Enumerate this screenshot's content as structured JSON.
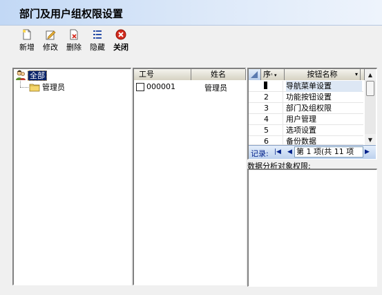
{
  "window": {
    "title": "部门及用户组权限设置"
  },
  "toolbar": {
    "buttons": [
      {
        "label": "新增",
        "icon": "new-file-icon"
      },
      {
        "label": "修改",
        "icon": "edit-icon"
      },
      {
        "label": "删除",
        "icon": "delete-file-icon"
      },
      {
        "label": "隐藏",
        "icon": "hide-list-icon"
      },
      {
        "label": "关闭",
        "icon": "close-circle-icon"
      }
    ]
  },
  "tree": {
    "root_label": "全部",
    "children": [
      "管理员"
    ]
  },
  "users": {
    "columns": [
      "工号",
      "姓名"
    ],
    "rows": [
      {
        "id": "000001",
        "name": "管理员",
        "checked": false
      }
    ]
  },
  "permissions": {
    "columns": [
      "序",
      "按钮名称"
    ],
    "rows": [
      {
        "seq": "1",
        "name": "导航菜单设置"
      },
      {
        "seq": "2",
        "name": "功能按钮设置"
      },
      {
        "seq": "3",
        "name": "部门及组权限"
      },
      {
        "seq": "4",
        "name": "用户管理"
      },
      {
        "seq": "5",
        "name": "选项设置"
      },
      {
        "seq": "6",
        "name": "备份数据"
      }
    ],
    "navigator": {
      "label": "记录:",
      "position_text": "第 1 项(共 11 项"
    }
  },
  "data_analysis": {
    "label": "数据分析对象权限:"
  },
  "colors": {
    "selection": "#0a246a",
    "titlebar": "#c2d8f5",
    "close_red": "#d42b1e"
  }
}
